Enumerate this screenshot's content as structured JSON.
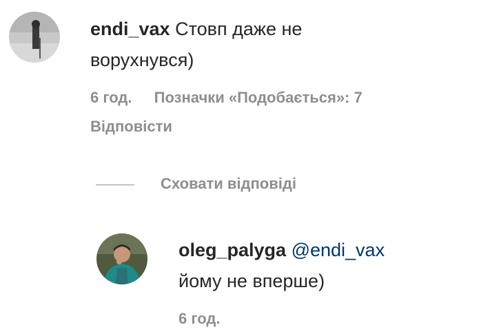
{
  "comment": {
    "username": "endi_vax",
    "text_line1": "Стовп даже не",
    "text_line2": "ворухнувся)",
    "time": "6 год.",
    "likes": "Позначки «Подобається»: 7",
    "reply": "Відповісти"
  },
  "replies_toggle": {
    "label": "Сховати відповіді"
  },
  "reply": {
    "username": "oleg_palyga",
    "mention": "@endi_vax",
    "text": "йому не вперше)",
    "time": "6 год."
  }
}
